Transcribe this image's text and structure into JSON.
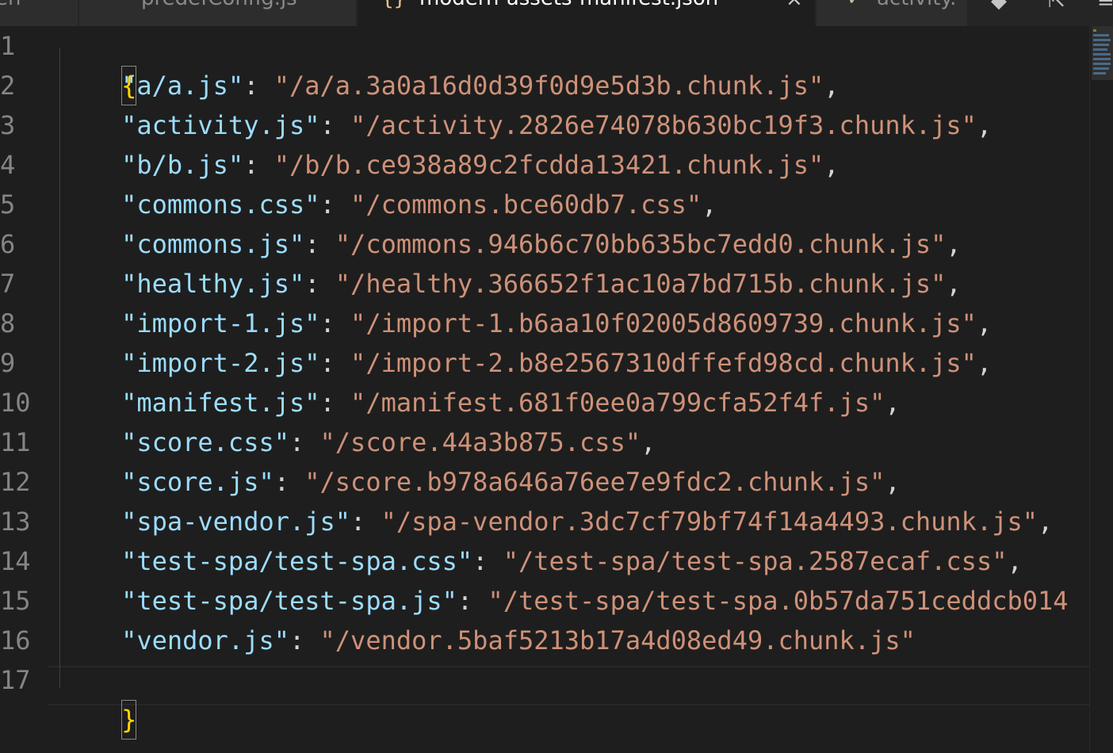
{
  "tabs": [
    {
      "label": "en",
      "active": false
    },
    {
      "label": "predefConfig.js",
      "active": false
    },
    {
      "label": "modern-assets-manifest.json",
      "icon": "{}",
      "active": true,
      "close": "×"
    },
    {
      "label": "activity.",
      "icon": "✓",
      "active": false
    }
  ],
  "toolbar": {
    "compare_icon": "◆",
    "split_icon": "⇱",
    "more_icon": "≡"
  },
  "editor": {
    "line_numbers": [
      "1",
      "2",
      "3",
      "4",
      "5",
      "6",
      "7",
      "8",
      "9",
      "10",
      "11",
      "12",
      "13",
      "14",
      "15",
      "16",
      "17"
    ],
    "open_brace": "{",
    "close_brace": "}",
    "entries": [
      {
        "key": "\"a/a.js\"",
        "value": "\"/a/a.3a0a16d0d39f0d9e5d3b.chunk.js\"",
        "comma": ","
      },
      {
        "key": "\"activity.js\"",
        "value": "\"/activity.2826e74078b630bc19f3.chunk.js\"",
        "comma": ","
      },
      {
        "key": "\"b/b.js\"",
        "value": "\"/b/b.ce938a89c2fcdda13421.chunk.js\"",
        "comma": ","
      },
      {
        "key": "\"commons.css\"",
        "value": "\"/commons.bce60db7.css\"",
        "comma": ","
      },
      {
        "key": "\"commons.js\"",
        "value": "\"/commons.946b6c70bb635bc7edd0.chunk.js\"",
        "comma": ","
      },
      {
        "key": "\"healthy.js\"",
        "value": "\"/healthy.366652f1ac10a7bd715b.chunk.js\"",
        "comma": ","
      },
      {
        "key": "\"import-1.js\"",
        "value": "\"/import-1.b6aa10f02005d8609739.chunk.js\"",
        "comma": ","
      },
      {
        "key": "\"import-2.js\"",
        "value": "\"/import-2.b8e2567310dffefd98cd.chunk.js\"",
        "comma": ","
      },
      {
        "key": "\"manifest.js\"",
        "value": "\"/manifest.681f0ee0a799cfa52f4f.js\"",
        "comma": ","
      },
      {
        "key": "\"score.css\"",
        "value": "\"/score.44a3b875.css\"",
        "comma": ","
      },
      {
        "key": "\"score.js\"",
        "value": "\"/score.b978a646a76ee7e9fdc2.chunk.js\"",
        "comma": ","
      },
      {
        "key": "\"spa-vendor.js\"",
        "value": "\"/spa-vendor.3dc7cf79bf74f14a4493.chunk.js\"",
        "comma": ","
      },
      {
        "key": "\"test-spa/test-spa.css\"",
        "value": "\"/test-spa/test-spa.2587ecaf.css\"",
        "comma": ","
      },
      {
        "key": "\"test-spa/test-spa.js\"",
        "value": "\"/test-spa/test-spa.0b57da751ceddcb014",
        "comma": ""
      },
      {
        "key": "\"vendor.js\"",
        "value": "\"/vendor.5baf5213b17a4d08ed49.chunk.js\"",
        "comma": ""
      }
    ],
    "colon": ": "
  },
  "colors": {
    "background": "#1e1e1e",
    "key": "#9cdcfe",
    "string": "#ce9178",
    "brace": "#ffd700",
    "line_number": "#858585"
  }
}
